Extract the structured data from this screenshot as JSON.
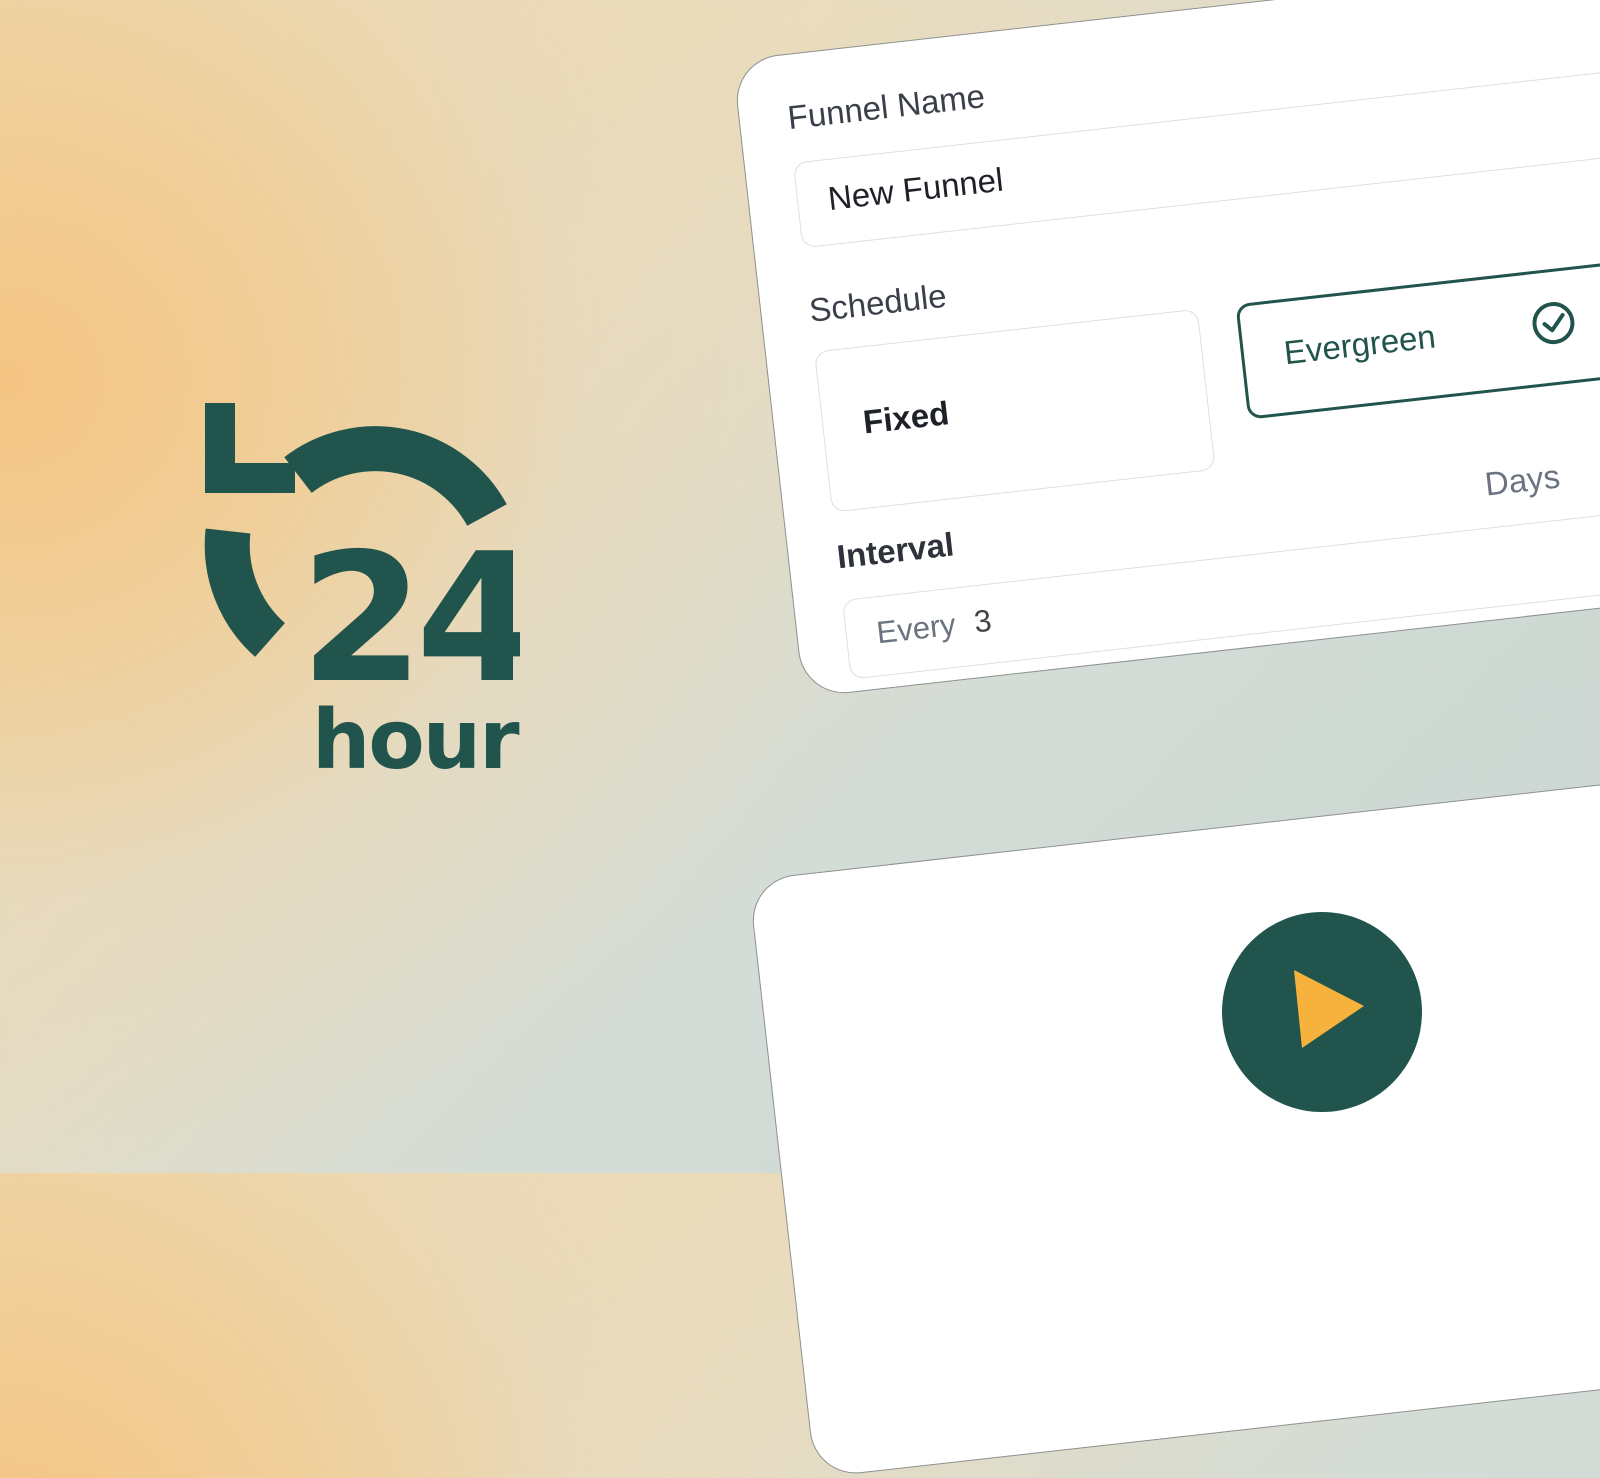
{
  "logo": {
    "number": "24",
    "word": "hour",
    "icon": "24-hour-clock-icon",
    "color": "#21544c"
  },
  "form": {
    "funnel_name_label": "Funnel Name",
    "funnel_name_value": "New Funnel",
    "schedule_label": "Schedule",
    "schedule_options": [
      {
        "label": "Fixed",
        "selected": false
      },
      {
        "label": "Evergreen",
        "selected": true
      }
    ],
    "interval_label": "Interval",
    "interval_prefix": "Every",
    "interval_value": "3",
    "interval_unit": "Days"
  },
  "video": {
    "play_icon": "play-icon",
    "button_color": "#21544c",
    "icon_color": "#f6b23c"
  }
}
